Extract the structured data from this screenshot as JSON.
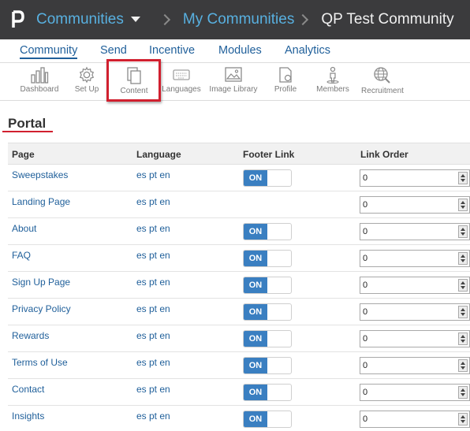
{
  "topbar": {
    "app_menu": "Communities",
    "crumb_link": "My Communities",
    "crumb_current": "QP Test Community"
  },
  "mainnav": {
    "items": [
      "Community",
      "Send",
      "Incentive",
      "Modules",
      "Analytics"
    ],
    "active": "Community"
  },
  "subnav": {
    "items": [
      {
        "label": "Dashboard",
        "icon": "bar-chart-icon"
      },
      {
        "label": "Set Up",
        "icon": "gear-icon"
      },
      {
        "label": "Content",
        "icon": "documents-icon"
      },
      {
        "label": "Languages",
        "icon": "keyboard-icon"
      },
      {
        "label": "Image Library",
        "icon": "image-icon"
      },
      {
        "label": "Profile",
        "icon": "profile-icon"
      },
      {
        "label": "Members",
        "icon": "member-icon"
      },
      {
        "label": "Recruitment",
        "icon": "globe-search-icon"
      }
    ],
    "selected": "Content"
  },
  "section": {
    "title": "Portal"
  },
  "table": {
    "headers": [
      "Page",
      "Language",
      "Footer Link",
      "Link Order"
    ],
    "rows": [
      {
        "page": "Sweepstakes",
        "languages": "es pt en",
        "footer": "ON",
        "order": "0"
      },
      {
        "page": "Landing Page",
        "languages": "es pt en",
        "footer": "",
        "order": "0"
      },
      {
        "page": "About",
        "languages": "es pt en",
        "footer": "ON",
        "order": "0"
      },
      {
        "page": "FAQ",
        "languages": "es pt en",
        "footer": "ON",
        "order": "0"
      },
      {
        "page": "Sign Up Page",
        "languages": "es pt en",
        "footer": "ON",
        "order": "0"
      },
      {
        "page": "Privacy Policy",
        "languages": "es pt en",
        "footer": "ON",
        "order": "0"
      },
      {
        "page": "Rewards",
        "languages": "es pt en",
        "footer": "ON",
        "order": "0"
      },
      {
        "page": "Terms of Use",
        "languages": "es pt en",
        "footer": "ON",
        "order": "0"
      },
      {
        "page": "Contact",
        "languages": "es pt en",
        "footer": "ON",
        "order": "0"
      },
      {
        "page": "Insights",
        "languages": "es pt en",
        "footer": "ON",
        "order": "0"
      }
    ]
  },
  "colors": {
    "topbar_bg": "#3b3b3d",
    "link_blue": "#1f5f9a",
    "toggle_on": "#3a7fc1",
    "highlight_red": "#d1202f"
  }
}
